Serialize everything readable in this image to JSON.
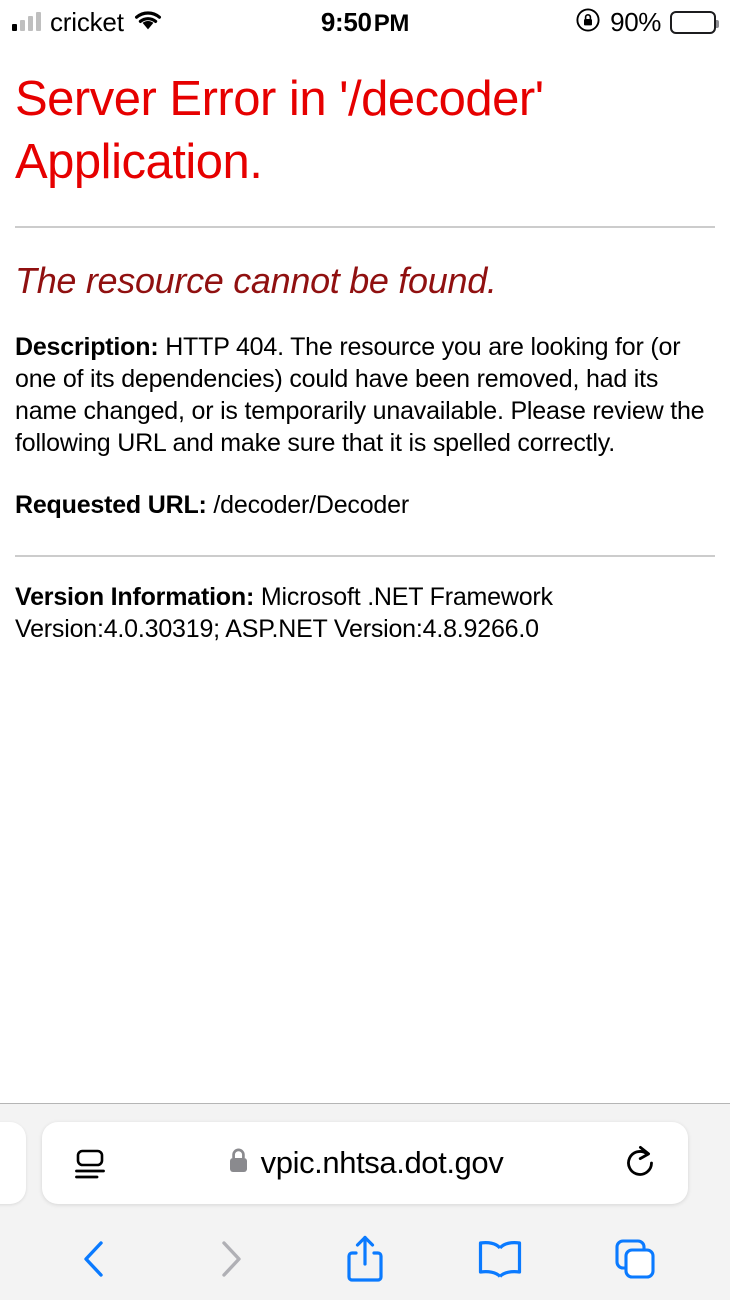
{
  "status_bar": {
    "carrier": "cricket",
    "signal_icon": "signal-bars-icon",
    "wifi_icon": "wifi-icon",
    "time": "9:50",
    "time_ampm": "PM",
    "rotation_lock_icon": "rotation-lock-icon",
    "battery_percent": "90%",
    "battery_icon": "battery-icon",
    "battery_level": 90
  },
  "page": {
    "title": "Server Error in '/decoder' Application.",
    "subtitle": "The resource cannot be found.",
    "description_label": "Description:",
    "description_text": " HTTP 404. The resource you are looking for (or one of its dependencies) could have been removed, had its name changed, or is temporarily unavailable.  Please review the following URL and make sure that it is spelled correctly.",
    "requested_url_label": "Requested URL:",
    "requested_url_value": " /decoder/Decoder",
    "version_label": "Version Information:",
    "version_value": " Microsoft .NET Framework Version:4.0.30319; ASP.NET Version:4.8.9266.0",
    "colors": {
      "title_red": "#e60000",
      "subtitle_dark_red": "#901010",
      "rule_gray": "#cccccc"
    }
  },
  "browser": {
    "format_button_icon": "page-settings-icon",
    "lock_icon": "lock-icon",
    "url": "vpic.nhtsa.dot.gov",
    "reload_icon": "reload-icon",
    "toolbar": {
      "back_icon": "back-chevron-icon",
      "forward_icon": "forward-chevron-icon",
      "share_icon": "share-icon",
      "bookmarks_icon": "bookmarks-book-icon",
      "tabs_icon": "tabs-icon"
    },
    "colors": {
      "accent_blue": "#0a7aff",
      "disabled_gray": "#b0b0b5",
      "bar_background": "#f3f3f3"
    }
  }
}
